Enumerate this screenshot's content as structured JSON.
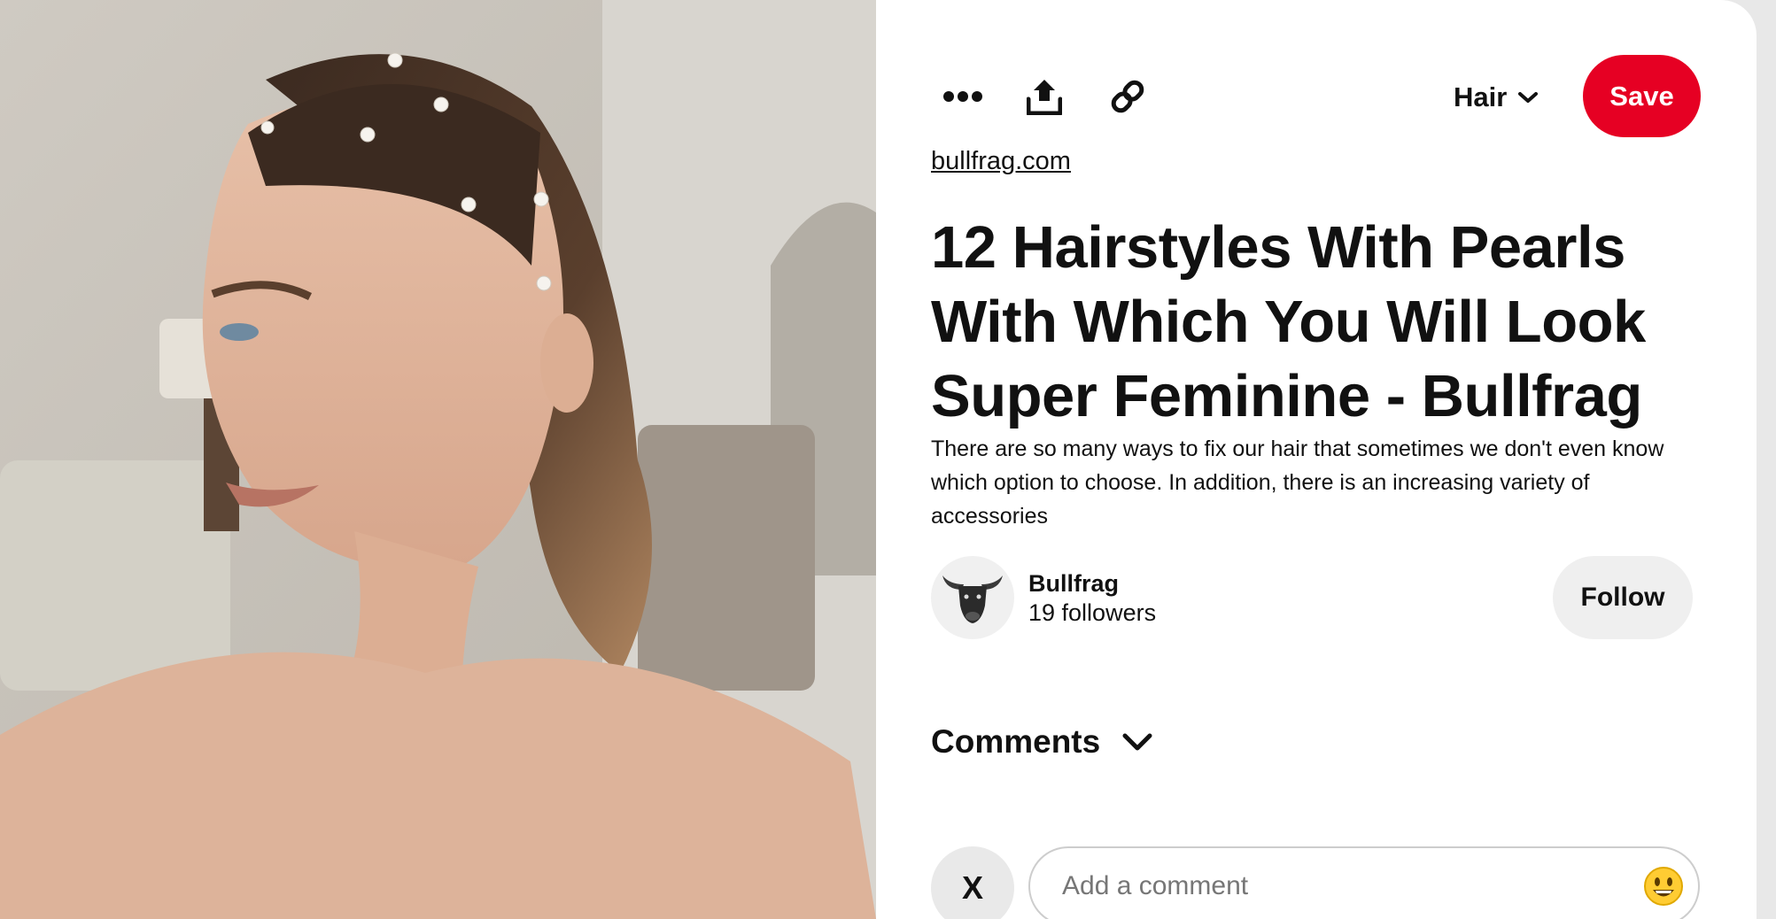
{
  "toolbar": {
    "more_icon": "ellipsis-icon",
    "share_icon": "share-upload-icon",
    "link_icon": "link-icon",
    "board_label": "Hair",
    "save_label": "Save"
  },
  "pin": {
    "source_domain": "bullfrag.com",
    "title": "12 Hairstyles With Pearls With Which You Will Look Super Feminine - Bullfrag",
    "description": "There are so many ways to fix our hair that sometimes we don't even know which option to choose. In addition, there is an increasing variety of accessories"
  },
  "author": {
    "name": "Bullfrag",
    "followers": "19 followers",
    "follow_label": "Follow"
  },
  "comments": {
    "label": "Comments",
    "user_initial": "X",
    "placeholder": "Add a comment"
  },
  "colors": {
    "save_red": "#e60023",
    "follow_bg": "#efefef",
    "text": "#111111"
  }
}
